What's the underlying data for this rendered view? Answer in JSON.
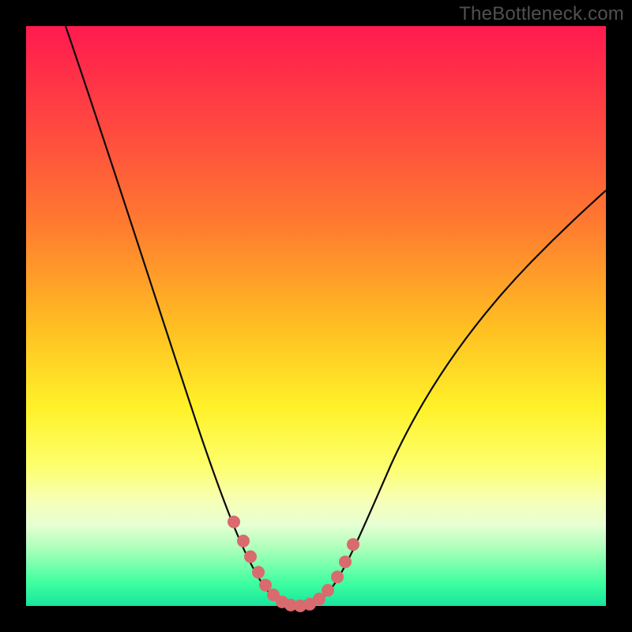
{
  "watermark": "TheBottleneck.com",
  "chart_data": {
    "type": "line",
    "title": "",
    "xlabel": "",
    "ylabel": "",
    "x_range": [
      0,
      734
    ],
    "y_range_percent": [
      0,
      100
    ],
    "background_gradient_stops": [
      {
        "pct": 0,
        "color": "#ff1a4f"
      },
      {
        "pct": 18,
        "color": "#ff4a3f"
      },
      {
        "pct": 34,
        "color": "#ff7a30"
      },
      {
        "pct": 52,
        "color": "#ffbf22"
      },
      {
        "pct": 66,
        "color": "#fff22a"
      },
      {
        "pct": 76,
        "color": "#fdff6e"
      },
      {
        "pct": 82,
        "color": "#f6ffb7"
      },
      {
        "pct": 86,
        "color": "#e7ffd3"
      },
      {
        "pct": 90,
        "color": "#aeffba"
      },
      {
        "pct": 96,
        "color": "#3fffa0"
      },
      {
        "pct": 100,
        "color": "#17e59d"
      }
    ],
    "series": [
      {
        "name": "bottleneck-curve",
        "color": "#0a0a0a",
        "stroke_width": 2,
        "points": [
          {
            "x": 50,
            "y_pct": 100
          },
          {
            "x": 95,
            "y_pct": 82
          },
          {
            "x": 140,
            "y_pct": 63
          },
          {
            "x": 180,
            "y_pct": 46
          },
          {
            "x": 220,
            "y_pct": 30
          },
          {
            "x": 255,
            "y_pct": 17
          },
          {
            "x": 278,
            "y_pct": 10
          },
          {
            "x": 295,
            "y_pct": 5
          },
          {
            "x": 310,
            "y_pct": 2
          },
          {
            "x": 330,
            "y_pct": 0
          },
          {
            "x": 356,
            "y_pct": 0
          },
          {
            "x": 380,
            "y_pct": 2
          },
          {
            "x": 398,
            "y_pct": 6
          },
          {
            "x": 420,
            "y_pct": 12
          },
          {
            "x": 460,
            "y_pct": 24
          },
          {
            "x": 510,
            "y_pct": 37
          },
          {
            "x": 570,
            "y_pct": 49
          },
          {
            "x": 640,
            "y_pct": 60
          },
          {
            "x": 734,
            "y_pct": 72
          }
        ]
      }
    ],
    "markers": {
      "color": "#d96a6e",
      "radius": 8,
      "points": [
        {
          "x": 263,
          "y_pct": 14.5
        },
        {
          "x": 275,
          "y_pct": 11.2
        },
        {
          "x": 284,
          "y_pct": 8.5
        },
        {
          "x": 294,
          "y_pct": 5.8
        },
        {
          "x": 303,
          "y_pct": 3.6
        },
        {
          "x": 313,
          "y_pct": 1.9
        },
        {
          "x": 324,
          "y_pct": 0.7
        },
        {
          "x": 335,
          "y_pct": 0.15
        },
        {
          "x": 347,
          "y_pct": 0.0
        },
        {
          "x": 359,
          "y_pct": 0.3
        },
        {
          "x": 371,
          "y_pct": 1.2
        },
        {
          "x": 382,
          "y_pct": 2.7
        },
        {
          "x": 394,
          "y_pct": 5.0
        },
        {
          "x": 404,
          "y_pct": 7.6
        },
        {
          "x": 414,
          "y_pct": 10.6
        }
      ]
    }
  }
}
